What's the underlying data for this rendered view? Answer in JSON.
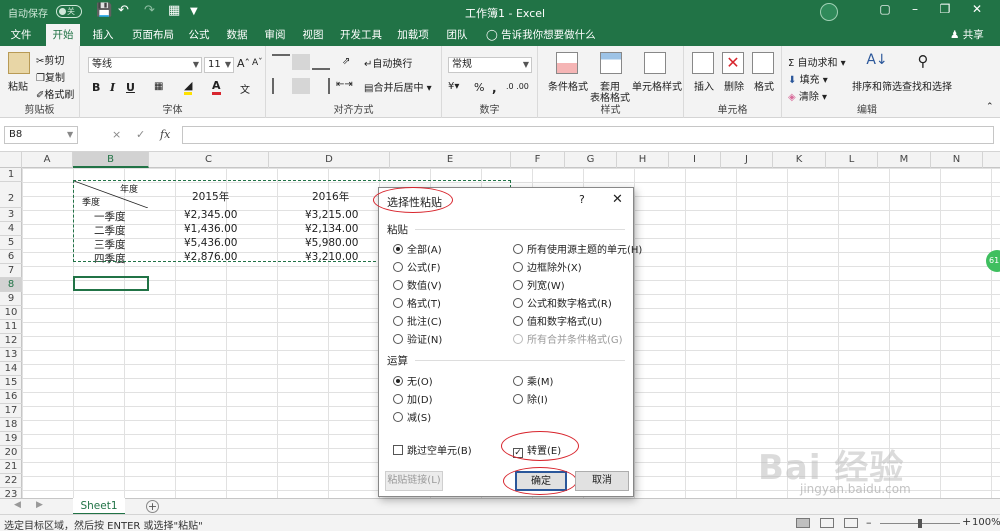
{
  "titlebar": {
    "autosave_label": "自动保存",
    "autosave_state": "关",
    "title": "工作簿1 - Excel"
  },
  "ribbon_tabs": [
    "文件",
    "开始",
    "插入",
    "页面布局",
    "公式",
    "数据",
    "审阅",
    "视图",
    "开发工具",
    "加载项",
    "团队"
  ],
  "active_tab": "开始",
  "tell_me": "告诉我你想要做什么",
  "share": "共享",
  "ribbon": {
    "clipboard": {
      "label": "剪贴板",
      "paste": "粘贴",
      "cut": "剪切",
      "copy": "复制",
      "format_painter": "格式刷"
    },
    "font": {
      "label": "字体",
      "font_name": "等线",
      "font_size": "11",
      "bold": "B",
      "italic": "I",
      "underline": "U"
    },
    "alignment": {
      "label": "对齐方式",
      "wrap": "自动换行",
      "merge": "合并后居中"
    },
    "number": {
      "label": "数字",
      "format": "常规",
      "percent": "%",
      "comma": ","
    },
    "styles": {
      "label": "样式",
      "conditional": "条件格式",
      "table_line1": "套用",
      "table_line2": "表格格式",
      "cell_styles": "单元格样式"
    },
    "cells": {
      "label": "单元格",
      "insert": "插入",
      "delete": "删除",
      "format": "格式"
    },
    "editing": {
      "label": "编辑",
      "autosum": "自动求和",
      "fill": "填充",
      "clear": "清除",
      "sort": "排序和筛选",
      "find": "查找和选择"
    }
  },
  "formula_bar": {
    "name_box": "B8",
    "fx": "fx",
    "cancel": "×",
    "enter": "✓"
  },
  "columns": [
    "A",
    "B",
    "C",
    "D",
    "E",
    "F",
    "G",
    "H",
    "I",
    "J",
    "K",
    "L",
    "M",
    "N"
  ],
  "rows": [
    "1",
    "2",
    "3",
    "4",
    "5",
    "6",
    "7",
    "8",
    "9",
    "10",
    "11",
    "12",
    "13",
    "14",
    "15",
    "16",
    "17",
    "18",
    "19",
    "20",
    "21",
    "22",
    "23"
  ],
  "sheet_cells": {
    "header_year": "年度",
    "header_quarter": "季度",
    "y2015": "2015年",
    "y2016": "2016年",
    "q1": "一季度",
    "q2": "二季度",
    "q3": "三季度",
    "q4": "四季度",
    "c3": "¥2,345.00",
    "c4": "¥1,436.00",
    "c5": "¥5,436.00",
    "c6": "¥2,876.00",
    "d3": "¥3,215.00",
    "d4": "¥2,134.00",
    "d5": "¥5,980.00",
    "d6": "¥3,210.00"
  },
  "sheet_tabs": {
    "sheet1": "Sheet1",
    "add": "+"
  },
  "status": {
    "message": "选定目标区域，然后按 ENTER 或选择\"粘贴\"",
    "zoom": "100%"
  },
  "dialog": {
    "title": "选择性粘贴",
    "help": "?",
    "close": "✕",
    "paste_section": "粘贴",
    "paste_options_left": [
      "全部(A)",
      "公式(F)",
      "数值(V)",
      "格式(T)",
      "批注(C)",
      "验证(N)"
    ],
    "paste_options_right": [
      "所有使用源主题的单元(H)",
      "边框除外(X)",
      "列宽(W)",
      "公式和数字格式(R)",
      "值和数字格式(U)",
      "所有合并条件格式(G)"
    ],
    "paste_selected": "全部(A)",
    "operation_section": "运算",
    "ops_left": [
      "无(O)",
      "加(D)",
      "减(S)"
    ],
    "ops_right": [
      "乘(M)",
      "除(I)"
    ],
    "op_selected": "无(O)",
    "skip_blanks": "跳过空单元(B)",
    "transpose": "转置(E)",
    "transpose_checked": true,
    "paste_link": "粘贴链接(L)",
    "ok": "确定",
    "cancel": "取消"
  },
  "side_badge": "61",
  "watermark": {
    "main": "Bai 经验",
    "sub": "jingyan.baidu.com"
  },
  "colors": {
    "excel_green": "#217346",
    "annotation_red": "#d8262e",
    "ok_border": "#2b579a"
  }
}
